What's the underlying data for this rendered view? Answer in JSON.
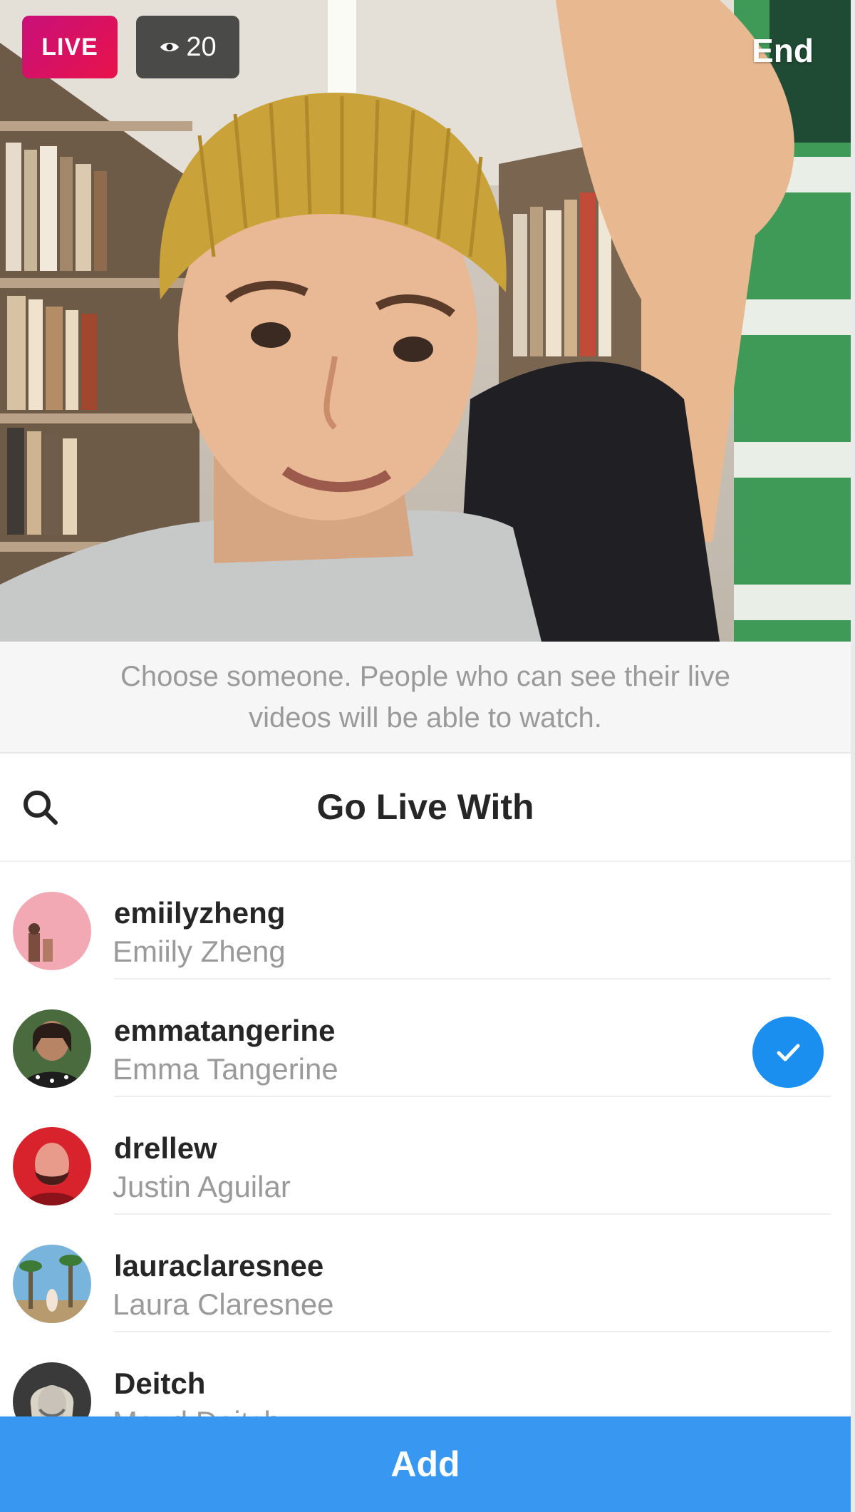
{
  "video": {
    "live_label": "LIVE",
    "viewer_count": "20",
    "viewer_icon": "eye-icon",
    "end_label": "End"
  },
  "info": {
    "text": "Choose someone. People who can see their live videos will be able to watch."
  },
  "header": {
    "title": "Go Live With",
    "search_icon": "search-icon"
  },
  "people": [
    {
      "username": "emiilyzheng",
      "full_name": "Emiily Zheng",
      "selected": false,
      "avatar_color": "#f3a9b3"
    },
    {
      "username": "emmatangerine",
      "full_name": "Emma Tangerine",
      "selected": true,
      "avatar_color": "#3f5e3a"
    },
    {
      "username": "drellew",
      "full_name": "Justin Aguilar",
      "selected": false,
      "avatar_color": "#d8232d"
    },
    {
      "username": "lauraclaresnee",
      "full_name": "Laura Claresnee",
      "selected": false,
      "avatar_color": "#6fa6cf"
    },
    {
      "username": "Deitch",
      "full_name": "Maud Deitch",
      "selected": false,
      "avatar_color": "#5a5a5a"
    }
  ],
  "add_button": {
    "label": "Add"
  },
  "colors": {
    "live_gradient_start": "#c8107a",
    "live_gradient_end": "#e8124a",
    "checkmark_blue": "#1b8ff0",
    "add_button_blue": "#3897f0"
  }
}
